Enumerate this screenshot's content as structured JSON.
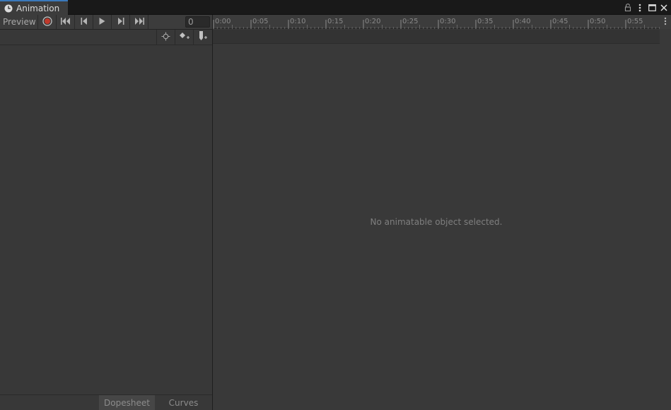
{
  "window": {
    "tab_title": "Animation",
    "icons": [
      "clock-icon",
      "lock-icon",
      "kebab-menu-icon",
      "maximize-icon",
      "close-icon"
    ]
  },
  "toolbar": {
    "preview_label": "Preview",
    "buttons": [
      "record-icon",
      "first-key-icon",
      "prev-key-icon",
      "play-icon",
      "next-key-icon",
      "last-key-icon"
    ],
    "frame_value": "0"
  },
  "toolbar2": {
    "buttons": [
      "filter-by-selection-icon",
      "add-keyframe-icon",
      "add-event-icon"
    ]
  },
  "timeline": {
    "labels": [
      "0:00",
      "0:05",
      "0:10",
      "0:15",
      "0:20",
      "0:25",
      "0:30",
      "0:35",
      "0:40",
      "0:45",
      "0:50",
      "0:55"
    ]
  },
  "main": {
    "empty_message": "No animatable object selected."
  },
  "bottom_tabs": {
    "dopesheet": "Dopesheet",
    "curves": "Curves",
    "active": "dopesheet"
  },
  "colors": {
    "accent": "#3a79bb",
    "record": "#c0392b"
  }
}
